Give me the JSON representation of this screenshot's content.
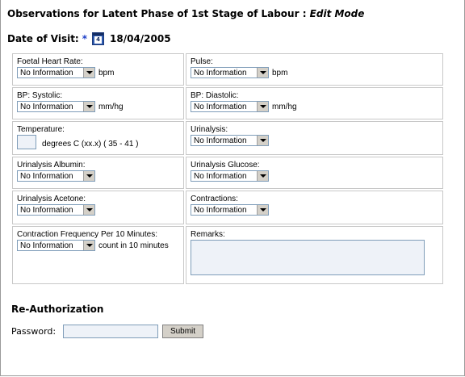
{
  "page": {
    "title_main": "Observations for Latent Phase of 1st Stage of Labour : ",
    "title_mode": "Edit Mode",
    "visit_label": "Date of Visit:",
    "required_marker": "*",
    "calendar_icon_day": "4",
    "visit_date": "18/04/2005"
  },
  "form": {
    "foetal_heart_rate": {
      "label": "Foetal Heart Rate:",
      "value": "No Information",
      "unit": "bpm"
    },
    "pulse": {
      "label": "Pulse:",
      "value": "No Information",
      "unit": "bpm"
    },
    "bp_systolic": {
      "label": "BP: Systolic:",
      "value": "No Information",
      "unit": "mm/hg"
    },
    "bp_diastolic": {
      "label": "BP: Diastolic:",
      "value": "No Information",
      "unit": "mm/hg"
    },
    "temperature": {
      "label": "Temperature:",
      "value": "",
      "unit": "degrees C (xx.x) ( 35 - 41 )"
    },
    "urinalysis": {
      "label": "Urinalysis:",
      "value": "No Information"
    },
    "urinalysis_albumin": {
      "label": "Urinalysis Albumin:",
      "value": "No Information"
    },
    "urinalysis_glucose": {
      "label": "Urinalysis Glucose:",
      "value": "No Information"
    },
    "urinalysis_acetone": {
      "label": "Urinalysis Acetone:",
      "value": "No Information"
    },
    "contractions": {
      "label": "Contractions:",
      "value": "No Information"
    },
    "contraction_frequency": {
      "label": "Contraction Frequency Per 10 Minutes:",
      "value": "No Information",
      "unit": "count in 10 minutes"
    },
    "remarks": {
      "label": "Remarks:",
      "value": ""
    }
  },
  "reauth": {
    "title": "Re-Authorization",
    "password_label": "Password:",
    "submit_label": "Submit"
  }
}
